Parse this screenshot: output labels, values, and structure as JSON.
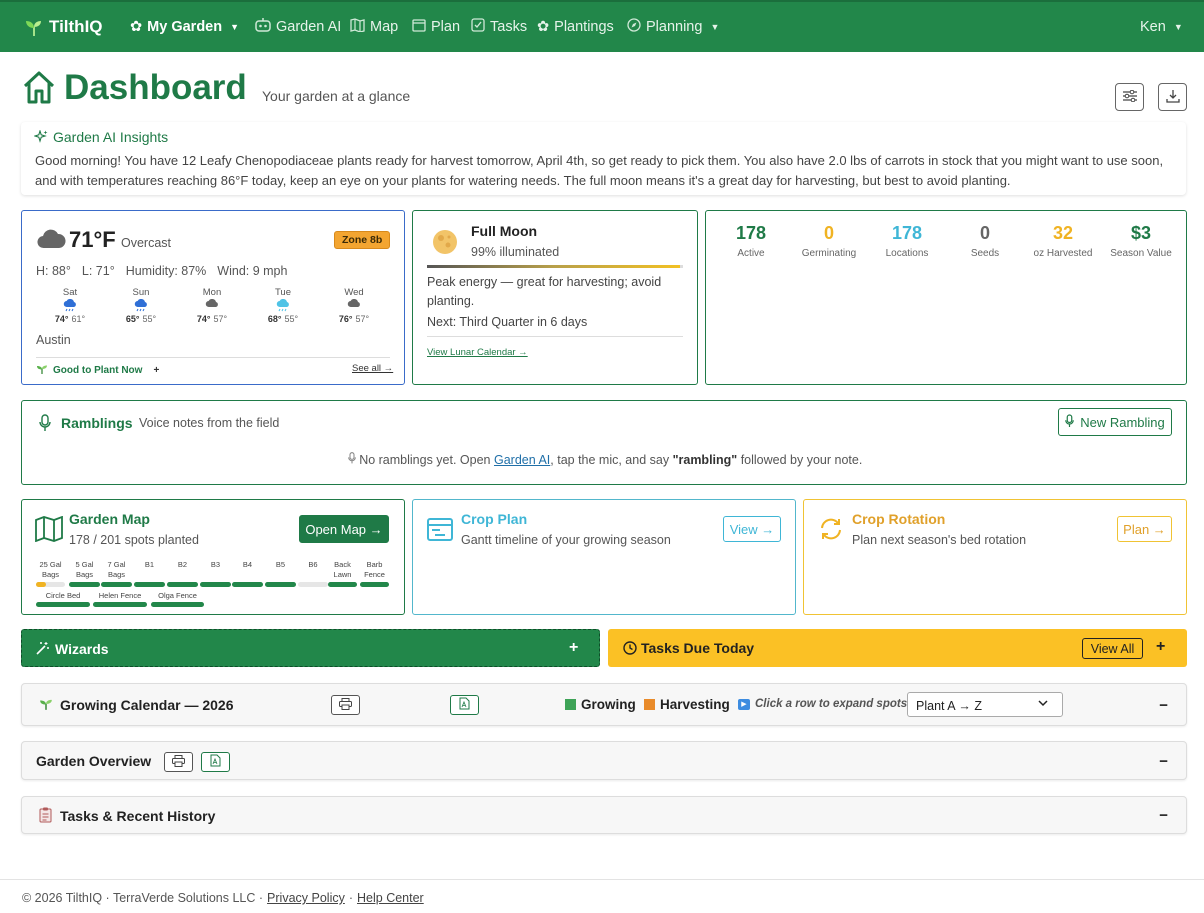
{
  "nav": {
    "brand": "TilthIQ",
    "items": [
      {
        "label": "My Garden",
        "icon": "flower-icon"
      },
      {
        "label": "Garden AI",
        "icon": "robot-icon"
      },
      {
        "label": "Map",
        "icon": "map-icon"
      },
      {
        "label": "Plan",
        "icon": "calendar-icon"
      },
      {
        "label": "Tasks",
        "icon": "checkbox-icon"
      },
      {
        "label": "Plantings",
        "icon": "flower-icon"
      },
      {
        "label": "Planning",
        "icon": "compass-icon"
      }
    ],
    "user": "Ken"
  },
  "header": {
    "title": "Dashboard",
    "subtitle": "Your garden at a glance"
  },
  "insights": {
    "title": "Garden AI Insights",
    "body": "Good morning! You have 12 Leafy Chenopodiaceae plants ready for harvest tomorrow, April 4th, so get ready to pick them. You also have 2.0 lbs of carrots in stock that you might want to use soon, and with temperatures reaching 86°F today, keep an eye on your plants for watering needs. The full moon means it's a great day for harvesting, but best to avoid planting."
  },
  "weather": {
    "temp": "71°F",
    "condition": "Overcast",
    "zone": "Zone 8b",
    "high": "H: 88°",
    "low": "L: 71°",
    "humidity": "Humidity: 87%",
    "wind": "Wind: 9 mph",
    "forecast": [
      {
        "day": "Sat",
        "hi": "74°",
        "lo": "61°",
        "icon": "rain-icon"
      },
      {
        "day": "Sun",
        "hi": "65°",
        "lo": "55°",
        "icon": "rain-icon"
      },
      {
        "day": "Mon",
        "hi": "74°",
        "lo": "57°",
        "icon": "cloud-icon"
      },
      {
        "day": "Tue",
        "hi": "68°",
        "lo": "55°",
        "icon": "rain-icon"
      },
      {
        "day": "Wed",
        "hi": "76°",
        "lo": "57°",
        "icon": "cloud-icon"
      }
    ],
    "location": "Austin",
    "plant_now": "Good to Plant Now",
    "plus": "+",
    "see_all": "See all →"
  },
  "moon": {
    "phase": "Full Moon",
    "illuminated": "99% illuminated",
    "illumination_fraction": 0.99,
    "advice": "Peak energy — great for harvesting; avoid planting.",
    "next": "Next: Third Quarter in 6 days",
    "link": "View Lunar Calendar →"
  },
  "stats": [
    {
      "value": "178",
      "label": "Active",
      "color": "#1f7a47"
    },
    {
      "value": "0",
      "label": "Germinating",
      "color": "#f0b323"
    },
    {
      "value": "178",
      "label": "Locations",
      "color": "#3fb6d6"
    },
    {
      "value": "0",
      "label": "Seeds",
      "color": "#666666"
    },
    {
      "value": "32",
      "label": "oz Harvested",
      "color": "#f0b323"
    },
    {
      "value": "$3",
      "label": "Season Value",
      "color": "#1f7a47"
    }
  ],
  "ramblings": {
    "title": "Ramblings",
    "subtitle": "Voice notes from the field",
    "button": "New Rambling",
    "empty_pre": "No ramblings yet. Open ",
    "empty_link": "Garden AI",
    "empty_mid": ", tap the mic, and say ",
    "empty_kw": "\"rambling\"",
    "empty_post": " followed by your note."
  },
  "garden_map": {
    "title": "Garden Map",
    "subtitle": "178 / 201 spots planted",
    "button": "Open Map →",
    "beds": [
      {
        "label": "25 Gal Bags",
        "fill": 0.35
      },
      {
        "label": "5 Gal Bags",
        "fill": 1
      },
      {
        "label": "7 Gal Bags",
        "fill": 1
      },
      {
        "label": "B1",
        "fill": 1
      },
      {
        "label": "B2",
        "fill": 1
      },
      {
        "label": "B3",
        "fill": 1
      },
      {
        "label": "B4",
        "fill": 1
      },
      {
        "label": "B5",
        "fill": 1
      },
      {
        "label": "B6",
        "fill": 0
      },
      {
        "label": "Back Lawn",
        "fill": 1
      },
      {
        "label": "Barb Fence",
        "fill": 1
      },
      {
        "label": "Circle Bed",
        "fill": 1
      },
      {
        "label": "Helen Fence",
        "fill": 1
      },
      {
        "label": "Olga Fence",
        "fill": 1
      }
    ]
  },
  "crop_plan": {
    "title": "Crop Plan",
    "subtitle": "Gantt timeline of your growing season",
    "button": "View →"
  },
  "crop_rotation": {
    "title": "Crop Rotation",
    "subtitle": "Plan next season's bed rotation",
    "button": "Plan →"
  },
  "wizards": {
    "title": "Wizards",
    "plus": "+"
  },
  "tasks_due": {
    "title": "Tasks Due Today",
    "button": "View All",
    "plus": "+"
  },
  "calendar": {
    "title": "Growing Calendar — 2026",
    "legend_growing": "Growing",
    "legend_harvesting": "Harvesting",
    "hint": "Click a row to expand spots",
    "sort": "Plant A → Z",
    "collapse": "−"
  },
  "overview": {
    "title": "Garden Overview",
    "collapse": "−"
  },
  "history": {
    "title": "Tasks & Recent History",
    "collapse": "−"
  },
  "footer": {
    "copyright": "© 2026 TilthIQ · TerraVerde Solutions LLC ·",
    "privacy": "Privacy Policy",
    "sep": "·",
    "help": "Help Center"
  },
  "colors": {
    "brand": "#22874a",
    "tasks": "#fbc125",
    "growing": "#3ea357",
    "harvesting": "#e98b2a"
  }
}
